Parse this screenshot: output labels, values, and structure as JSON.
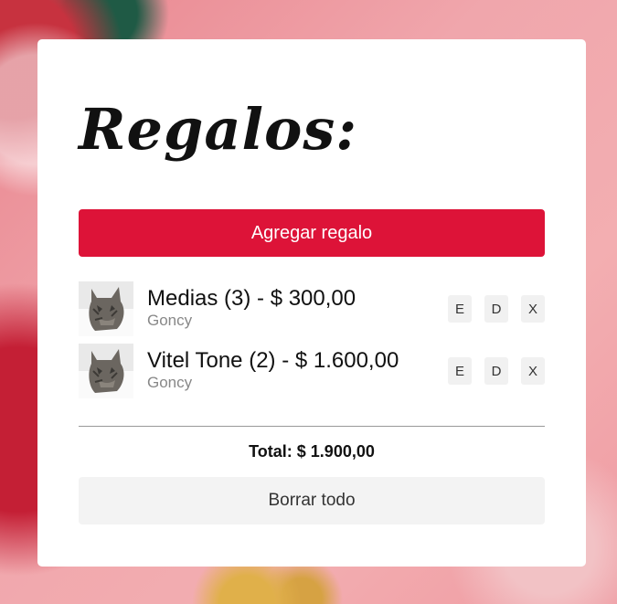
{
  "title": "Regalos:",
  "add_button_label": "Agregar regalo",
  "gifts": [
    {
      "name": "Medias (3) - $ 300,00",
      "owner": "Goncy",
      "thumb_icon": "cat-photo",
      "actions": [
        "E",
        "D",
        "X"
      ]
    },
    {
      "name": "Vitel Tone (2) - $ 1.600,00",
      "owner": "Goncy",
      "thumb_icon": "cat-photo",
      "actions": [
        "E",
        "D",
        "X"
      ]
    }
  ],
  "total_label": "Total: $ 1.900,00",
  "clear_button_label": "Borrar todo",
  "colors": {
    "accent": "#dd1338",
    "card": "#ffffff",
    "secondary_button": "#f3f3f3"
  }
}
